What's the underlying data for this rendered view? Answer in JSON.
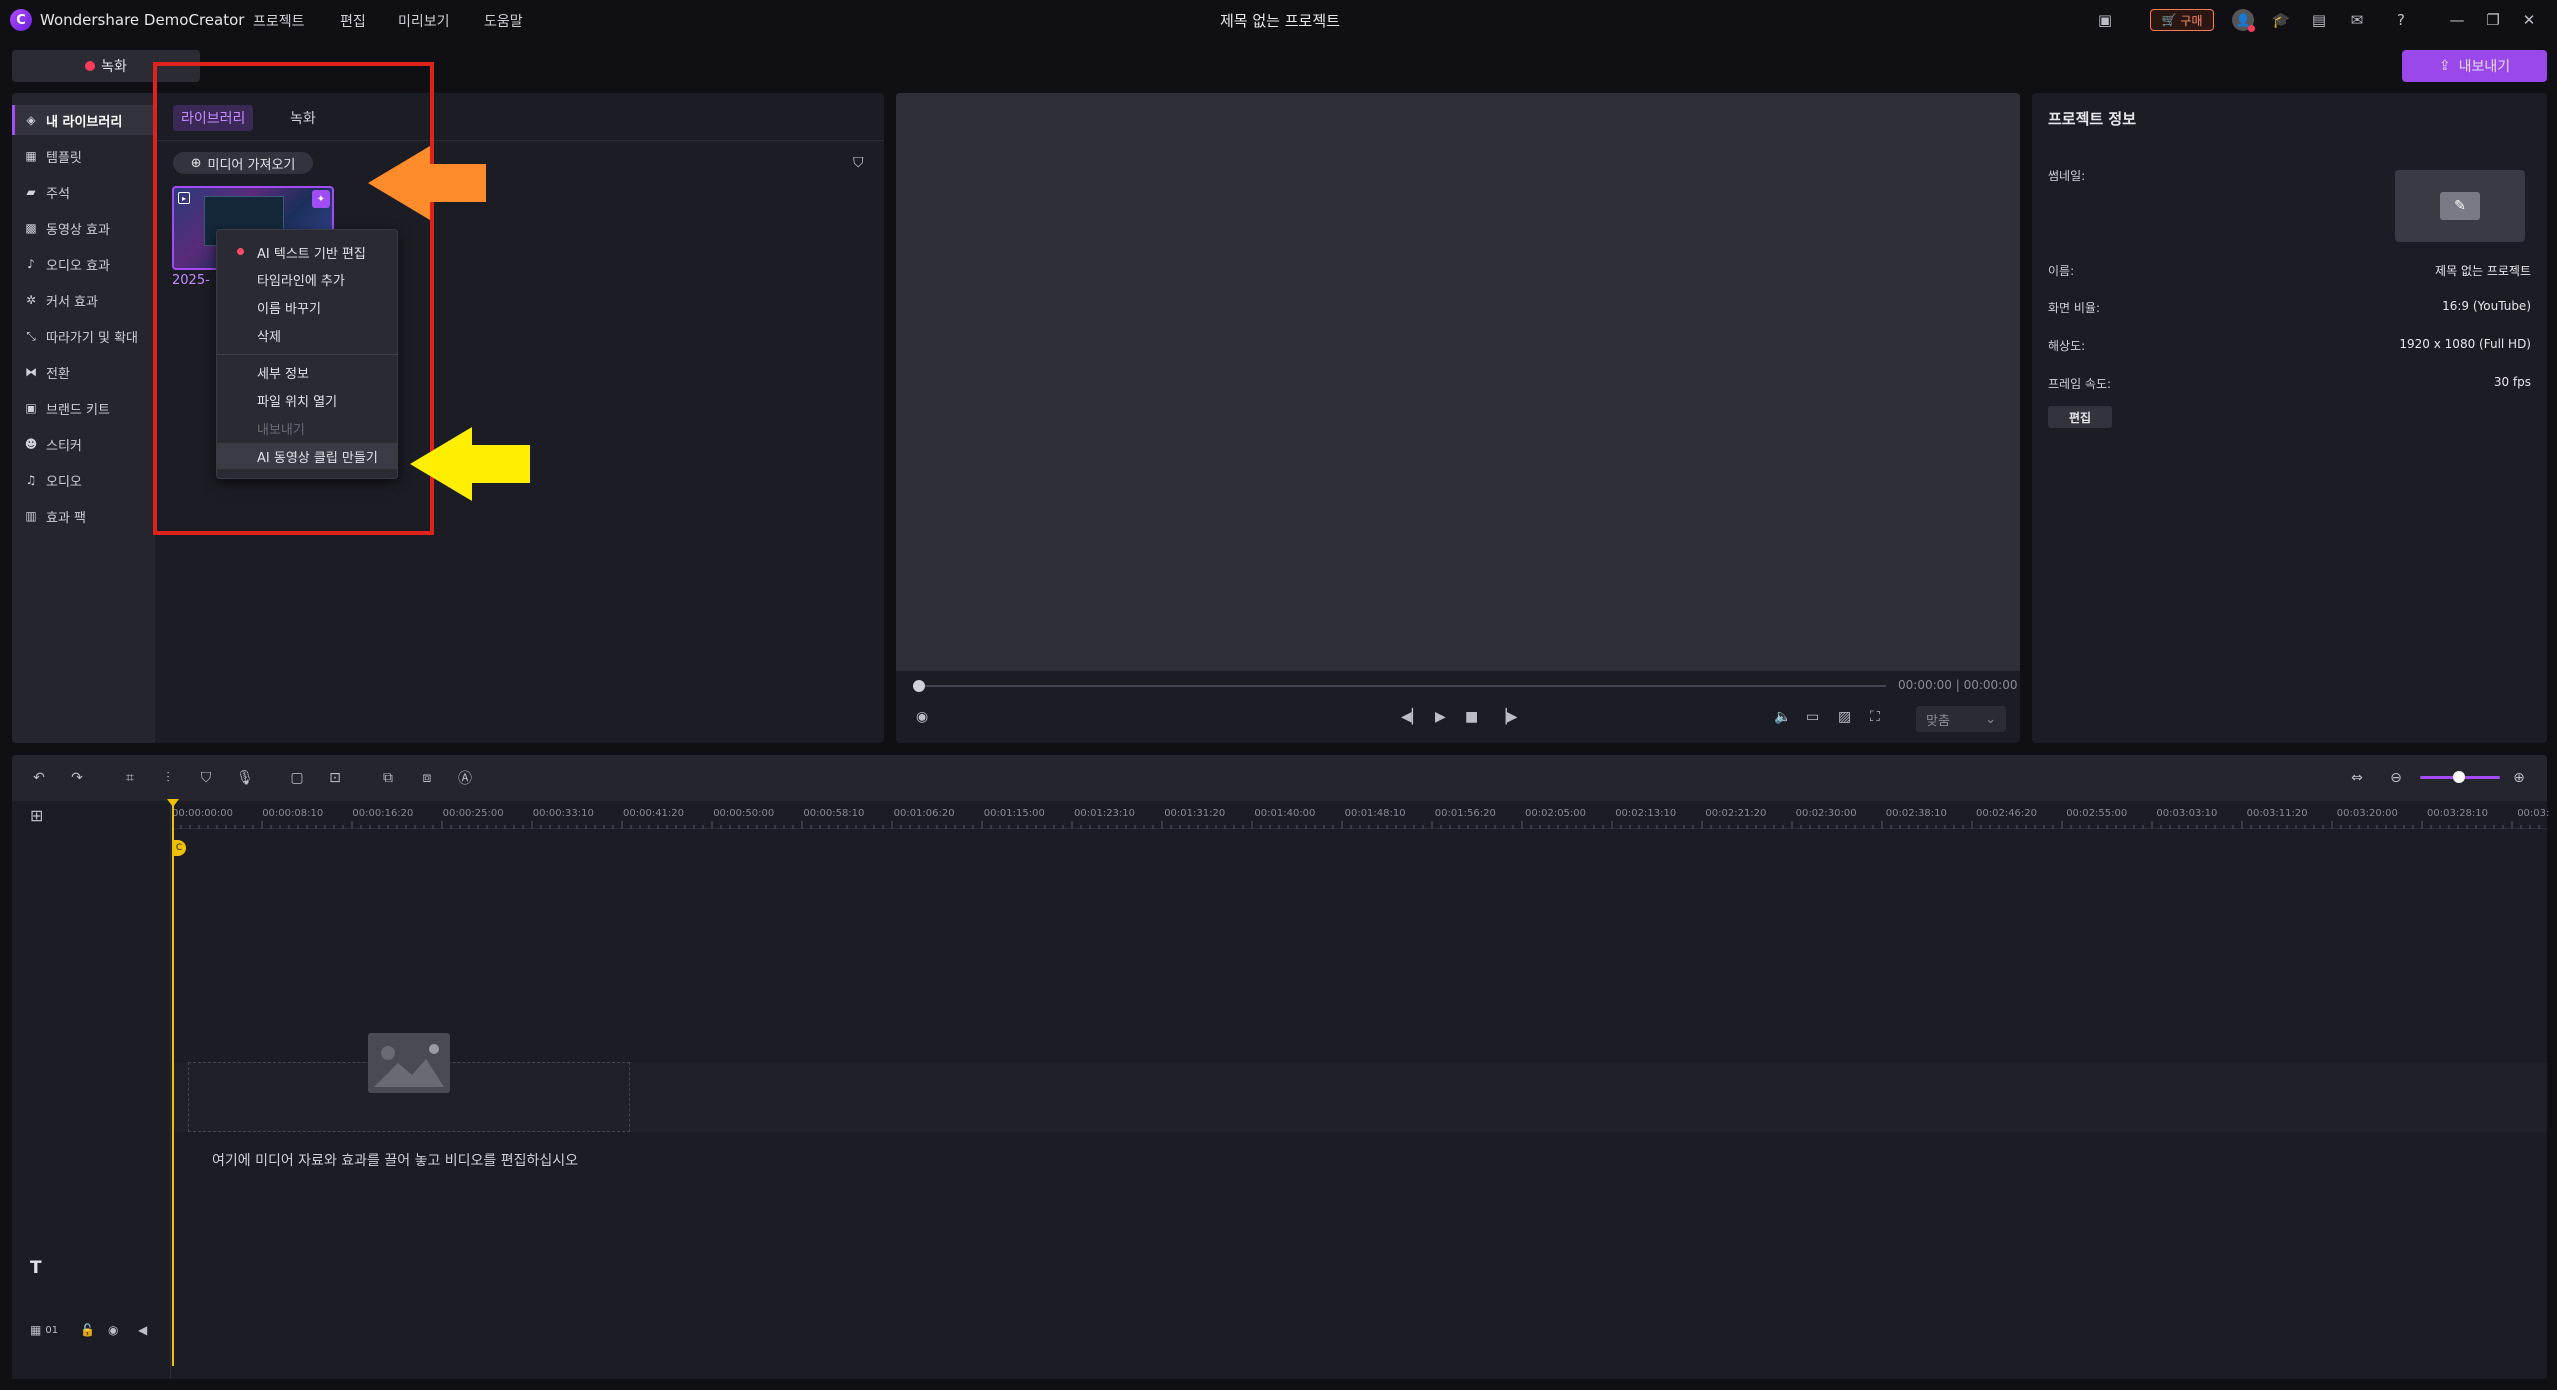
{
  "app": {
    "logo_letter": "C",
    "name": "Wondershare DemoCreator",
    "window_title": "제목 없는 프로젝트",
    "menu": [
      "프로젝트",
      "편집",
      "미리보기",
      "도움말"
    ],
    "buy_label": "구매"
  },
  "toolbar_top": {
    "record_label": "녹화",
    "export_label": "내보내기"
  },
  "library": {
    "sidebar": [
      {
        "label": "내 라이브러리",
        "icon": "layers-icon"
      },
      {
        "label": "템플릿",
        "icon": "template-icon"
      },
      {
        "label": "주석",
        "icon": "annotation-icon"
      },
      {
        "label": "동영상 효과",
        "icon": "video-effect-icon"
      },
      {
        "label": "오디오 효과",
        "icon": "audio-effect-icon"
      },
      {
        "label": "커서 효과",
        "icon": "cursor-effect-icon"
      },
      {
        "label": "따라가기 및 확대",
        "icon": "pan-zoom-icon"
      },
      {
        "label": "전환",
        "icon": "transition-icon"
      },
      {
        "label": "브랜드 키트",
        "icon": "brand-kit-icon"
      },
      {
        "label": "스티커",
        "icon": "sticker-icon"
      },
      {
        "label": "오디오",
        "icon": "music-icon"
      },
      {
        "label": "효과 팩",
        "icon": "effect-pack-icon"
      }
    ],
    "tabs": {
      "library": "라이브러리",
      "record": "녹화"
    },
    "import_label": "미디어 가져오기",
    "media_name": "2025-"
  },
  "context_menu": {
    "items": [
      {
        "label": "AI 텍스트 기반 편집",
        "disabled": false
      },
      {
        "label": "타임라인에 추가",
        "disabled": false
      },
      {
        "label": "이름 바꾸기",
        "disabled": false
      },
      {
        "label": "삭제",
        "disabled": false
      },
      {
        "label": "세부 정보",
        "disabled": false
      },
      {
        "label": "파일 위치 열기",
        "disabled": false
      },
      {
        "label": "내보내기",
        "disabled": true
      },
      {
        "label": "AI 동영상 클립 만들기",
        "disabled": false
      }
    ]
  },
  "preview": {
    "timecode": "00:00:00 | 00:00:00",
    "fit_label": "맞춤"
  },
  "project_info": {
    "title": "프로젝트 정보",
    "thumbnail_label": "썸네일:",
    "name_label": "이름:",
    "name_value": "제목 없는 프로젝트",
    "ratio_label": "화면 비율:",
    "ratio_value": "16:9 (YouTube)",
    "resolution_label": "해상도:",
    "resolution_value": "1920 x 1080 (Full HD)",
    "framerate_label": "프레임 속도:",
    "framerate_value": "30 fps",
    "edit_label": "편집"
  },
  "timeline": {
    "ruler": [
      "00:00:00:00",
      "00:00:08:10",
      "00:00:16:20",
      "00:00:25:00",
      "00:00:33:10",
      "00:00:41:20",
      "00:00:50:00",
      "00:00:58:10",
      "00:01:06:20",
      "00:01:15:00",
      "00:01:23:10",
      "00:01:31:20",
      "00:01:40:00",
      "00:01:48:10",
      "00:01:56:20",
      "00:02:05:00",
      "00:02:13:10",
      "00:02:21:20",
      "00:02:30:00",
      "00:02:38:10",
      "00:02:46:20",
      "00:02:55:00",
      "00:03:03:10",
      "00:03:11:20",
      "00:03:20:00",
      "00:03:28:10",
      "00:03:"
    ],
    "drop_hint": "여기에 미디어 자료와 효과를 끌어 놓고 비디오를 편집하십시오",
    "track_number": "01",
    "playhead_marker": "C"
  },
  "colors": {
    "accent": "#a24cf5",
    "highlight_box": "#e0221c",
    "arrow_orange": "#ff8c2a",
    "arrow_yellow": "#ffee00",
    "playhead": "#f0c000"
  }
}
